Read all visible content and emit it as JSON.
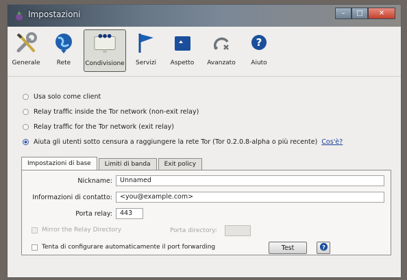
{
  "window": {
    "title": "Impostazioni",
    "minimize": "–",
    "maximize": "□",
    "close": "✕"
  },
  "toolbar": {
    "items": [
      {
        "label": "Generale",
        "icon": "wrench-screwdriver-icon"
      },
      {
        "label": "Rete",
        "icon": "network-globe-icon"
      },
      {
        "label": "Condivisione",
        "icon": "sharing-people-icon",
        "active": true
      },
      {
        "label": "Servizi",
        "icon": "flag-icon"
      },
      {
        "label": "Aspetto",
        "icon": "appearance-icon"
      },
      {
        "label": "Avanzato",
        "icon": "advanced-icon"
      },
      {
        "label": "Aiuto",
        "icon": "help-icon"
      }
    ]
  },
  "radios": [
    {
      "label": "Usa solo come client",
      "selected": false
    },
    {
      "label": "Relay traffic inside the Tor network (non-exit relay)",
      "selected": false
    },
    {
      "label": "Relay traffic for the Tor network (exit relay)",
      "selected": false
    },
    {
      "label": "Aiuta gli utenti sotto censura a raggiungere la rete Tor (Tor 0.2.0.8-alpha o più recente)",
      "selected": true
    }
  ],
  "help_link": "Cos'è?",
  "tabs": [
    {
      "label": "Impostazioni di base",
      "active": true
    },
    {
      "label": "Limiti di banda",
      "active": false
    },
    {
      "label": "Exit policy",
      "active": false
    }
  ],
  "form": {
    "nickname_label": "Nickname:",
    "nickname_value": "Unnamed",
    "contact_label": "Informazioni di contatto:",
    "contact_value": "<you@example.com>",
    "relay_port_label": "Porta relay:",
    "relay_port_value": "443",
    "mirror_label": "Mirror the Relay Directory",
    "dir_port_label": "Porta directory:",
    "dir_port_value": "",
    "upnp_label": "Tenta di configurare automaticamente il port forwarding",
    "test_button": "Test",
    "help_button_icon": "help-icon"
  }
}
